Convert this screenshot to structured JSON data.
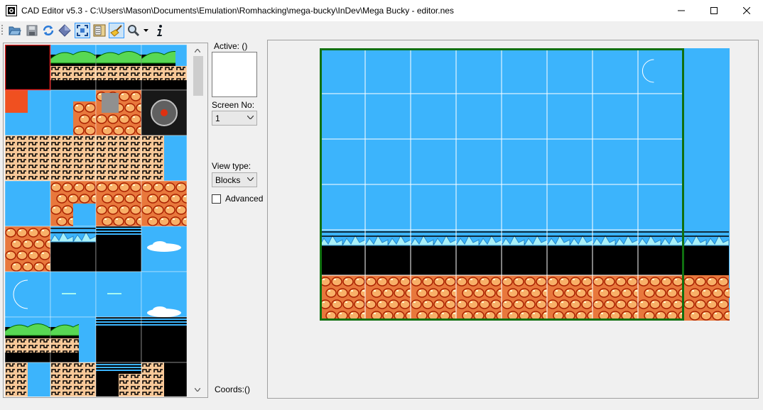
{
  "window": {
    "title": "CAD Editor v5.3 - C:\\Users\\Mason\\Documents\\Emulation\\Romhacking\\mega-bucky\\InDev\\Mega Bucky - editor.nes",
    "controls": [
      "minimize",
      "maximize",
      "close"
    ]
  },
  "toolbar": {
    "buttons": [
      {
        "name": "open-icon"
      },
      {
        "name": "save-icon"
      },
      {
        "name": "reload-icon"
      },
      {
        "name": "diamond-icon"
      },
      {
        "name": "fullscreen-icon",
        "pressed": true
      },
      {
        "name": "layout-icon"
      },
      {
        "name": "broom-icon",
        "pressed": true
      },
      {
        "name": "zoom-icon",
        "dropdown": true
      },
      {
        "name": "info-icon"
      }
    ]
  },
  "side": {
    "active_label": "Active: ()",
    "screen_no_label": "Screen No:",
    "screen_no_value": "1",
    "view_type_label": "View type:",
    "view_type_value": "Blocks",
    "advanced_label": "Advanced",
    "advanced_checked": false,
    "coords_label": "Coords:()"
  },
  "colors": {
    "sky": "#3cb4fc",
    "rock": "#e8783c",
    "rock_dark": "#a82000",
    "grass": "#58d854",
    "frame": "#107010",
    "selection": "#e02020"
  },
  "tileset": {
    "rows": [
      [
        "black",
        "grass-top",
        "grass-top",
        "grass-top-edge"
      ],
      [
        "sky-corner",
        "sky-rock",
        "rock-gray",
        "spike-ball"
      ],
      [
        "brick-block",
        "brick-block",
        "brick-block",
        "sky-brick"
      ],
      [
        "sky",
        "rock-sky",
        "rock",
        "rock"
      ],
      [
        "rock",
        "waves-black",
        "black-stripes",
        "cloud"
      ],
      [
        "moon",
        "sky-dash",
        "sky-dash",
        "sky-cloud"
      ],
      [
        "grass-top",
        "grass-brick",
        "black-stripes",
        "black-stripes"
      ],
      [
        "sky-brick",
        "brick",
        "stripe-brick",
        "brick-black"
      ]
    ],
    "selected": 0
  },
  "map": {
    "columns": 9,
    "rows": 6,
    "row_types": [
      "sky",
      "sky",
      "sky",
      "sky",
      "waves",
      "rock"
    ],
    "moon_col": 7
  }
}
